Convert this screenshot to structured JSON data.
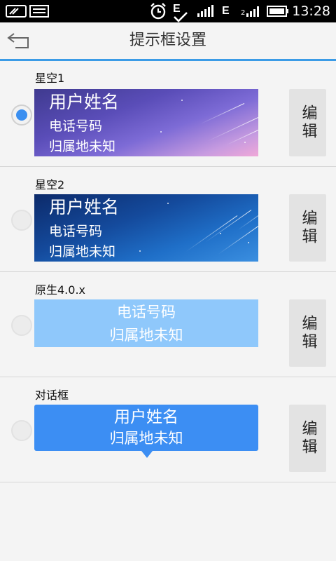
{
  "status_bar": {
    "time": "13:28",
    "network_letter_1": "E",
    "network_letter_2": "E",
    "icons": [
      "card-icon",
      "message-icon",
      "alarm-icon",
      "signal-icon",
      "battery-icon"
    ]
  },
  "header": {
    "title": "提示框设置",
    "back_icon": "back-arrow-icon",
    "accent_color": "#3b9be6"
  },
  "styles": [
    {
      "label": "星空1",
      "selected": true,
      "preview": {
        "name": "用户姓名",
        "phone": "电话号码",
        "location": "归属地未知"
      },
      "edit_label": "编辑"
    },
    {
      "label": "星空2",
      "selected": false,
      "preview": {
        "name": "用户姓名",
        "phone": "电话号码",
        "location": "归属地未知"
      },
      "edit_label": "编辑"
    },
    {
      "label": "原生4.0.x",
      "selected": false,
      "preview": {
        "phone": "电话号码",
        "location": "归属地未知"
      },
      "edit_label": "编辑"
    },
    {
      "label": "对话框",
      "selected": false,
      "preview": {
        "name": "用户姓名",
        "location": "归属地未知"
      },
      "edit_label": "编辑"
    }
  ]
}
